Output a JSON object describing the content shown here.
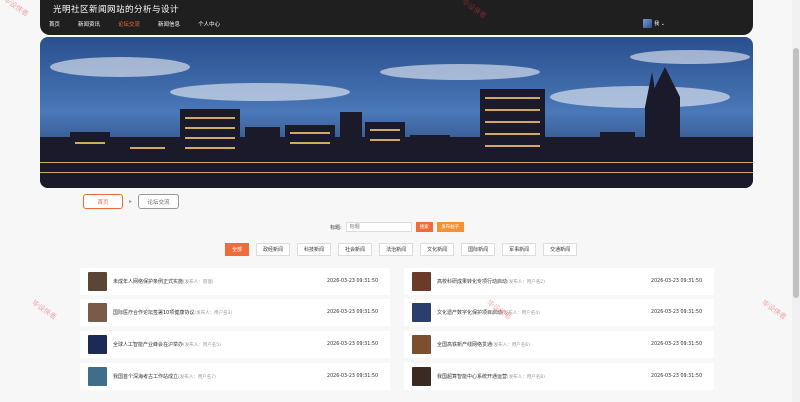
{
  "header": {
    "title": "光明社区新闻网站的分析与设计",
    "nav": [
      "首页",
      "新闻资讯",
      "论坛交流",
      "新闻信息",
      "个人中心"
    ],
    "user_label": "我 ⌄"
  },
  "breadcrumb": {
    "home": "首页",
    "separator": "▸",
    "current": "论坛交流"
  },
  "search": {
    "label": "标题:",
    "placeholder": "标题",
    "search_button": "搜索",
    "publish_button": "发布帖子"
  },
  "categories": [
    "全部",
    "政经新闻",
    "科技新闻",
    "社会新闻",
    "法治新闻",
    "文化新闻",
    "国际新闻",
    "军事新闻",
    "交通新闻"
  ],
  "news": [
    {
      "title": "未成年人网络保护条例正式实施",
      "author": "(发布人：管理)",
      "time": "2026-03-23 09:31:50",
      "thumb": "#5a4633"
    },
    {
      "title": "高校科研成果转化专项行动启动",
      "author": "(发布人：用户名2)",
      "time": "2026-03-23 09:31:50",
      "thumb": "#6b3b2a"
    },
    {
      "title": "国际医疗合作论坛签署10项健康协议",
      "author": "(发布人：用户名3)",
      "time": "2026-03-23 09:31:50",
      "thumb": "#7a5a48"
    },
    {
      "title": "文化遗产数字化保护项目启动",
      "author": "(发布人：用户名4)",
      "time": "2026-03-23 09:31:50",
      "thumb": "#2c3e6b"
    },
    {
      "title": "全球人工智能产业峰会在沪举办",
      "author": "(发布人：用户名5)",
      "time": "2026-03-23 09:31:50",
      "thumb": "#1c2b55"
    },
    {
      "title": "全国高铁新产线网络贯通",
      "author": "(发布人：用户名6)",
      "time": "2026-03-23 09:31:50",
      "thumb": "#7a5030"
    },
    {
      "title": "我国首个深海考古工作站成立",
      "author": "(发布人：用户名7)",
      "time": "2026-03-23 09:31:50",
      "thumb": "#3f6d8a"
    },
    {
      "title": "我国超算智能中心系统开通运营",
      "author": "(发布人：用户名8)",
      "time": "2026-03-23 09:31:50",
      "thumb": "#3a2a22"
    }
  ],
  "watermark": "毕设侠者"
}
